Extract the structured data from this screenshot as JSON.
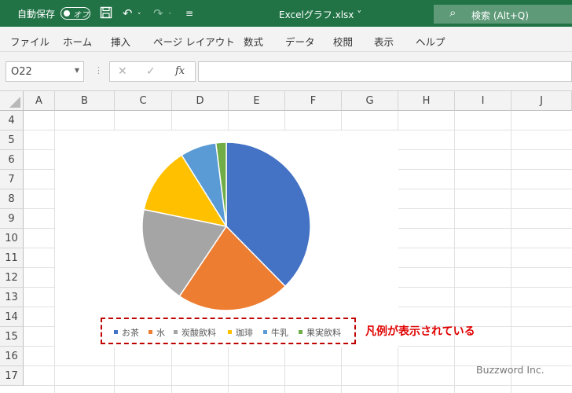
{
  "titlebar": {
    "autosave_label": "自動保存",
    "toggle_text": "オフ",
    "filename": "Excelグラフ.xlsx ˅",
    "search_text": "検索 (Alt+Q)"
  },
  "menu": [
    "ファイル",
    "ホーム",
    "挿入",
    "ページ レイアウト",
    "数式",
    "データ",
    "校閲",
    "表示",
    "ヘルプ"
  ],
  "formula_bar": {
    "name_box": "O22",
    "fx_label": "fx",
    "formula": ""
  },
  "columns": [
    "A",
    "B",
    "C",
    "D",
    "E",
    "F",
    "G",
    "H",
    "I",
    "J"
  ],
  "rows": [
    "4",
    "5",
    "6",
    "7",
    "8",
    "9",
    "10",
    "11",
    "12",
    "13",
    "14",
    "15",
    "16",
    "17"
  ],
  "chart_data": {
    "type": "pie",
    "categories": [
      "お茶",
      "水",
      "炭酸飲料",
      "珈琲",
      "牛乳",
      "果実飲料"
    ],
    "values": [
      38,
      22,
      19,
      13,
      7,
      2
    ],
    "colors": [
      "#4472c4",
      "#ed7d31",
      "#a5a5a5",
      "#ffc000",
      "#5b9bd5",
      "#70ad47"
    ],
    "legend_position": "bottom"
  },
  "annotation": "凡例が表示されている",
  "watermark": "Buzzword Inc."
}
